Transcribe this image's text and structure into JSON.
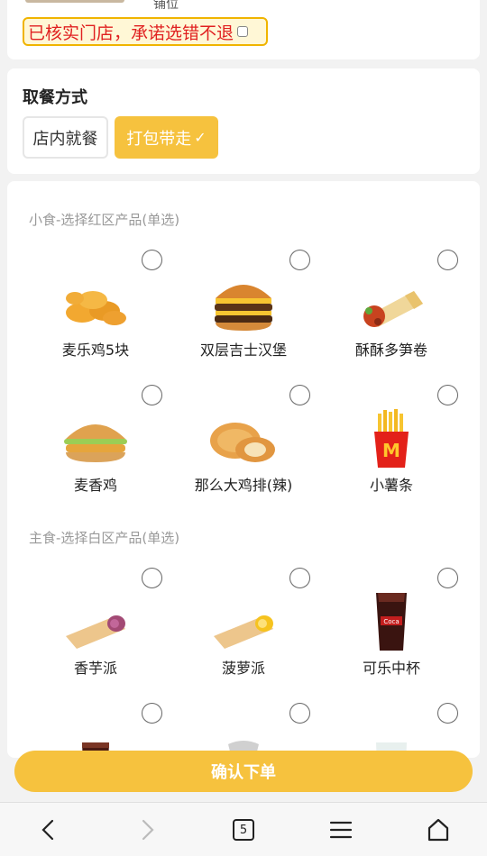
{
  "top": {
    "store_sub": "铺位",
    "promise_text": "已核实门店，承诺选错不退"
  },
  "mode": {
    "title": "取餐方式",
    "dine_in": "店内就餐",
    "take_out": "打包带走",
    "selected": "take_out"
  },
  "sections": {
    "snacks_title": "小食-选择红区产品(单选)",
    "mains_title": "主食-选择白区产品(单选)"
  },
  "snacks": [
    {
      "label": "麦乐鸡5块",
      "icon": "nuggets-icon"
    },
    {
      "label": "双层吉士汉堡",
      "icon": "double-cheeseburger-icon"
    },
    {
      "label": "酥酥多笋卷",
      "icon": "wrap-icon"
    },
    {
      "label": "麦香鸡",
      "icon": "chicken-burger-icon"
    },
    {
      "label": "那么大鸡排(辣)",
      "icon": "chicken-fillet-icon"
    },
    {
      "label": "小薯条",
      "icon": "fries-icon"
    }
  ],
  "mains": [
    {
      "label": "香芋派",
      "icon": "taro-pie-icon"
    },
    {
      "label": "菠萝派",
      "icon": "pineapple-pie-icon"
    },
    {
      "label": "可乐中杯",
      "icon": "cola-icon"
    }
  ],
  "confirm_label": "确认下单",
  "nav": {
    "tab_count": "5"
  },
  "colors": {
    "accent": "#f6c23e",
    "warning_text": "#e02020"
  }
}
